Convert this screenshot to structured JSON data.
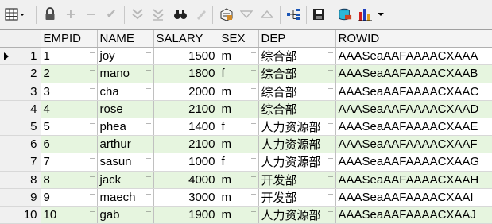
{
  "toolbar": {
    "buttons": [
      {
        "name": "grid-view-icon",
        "enabled": true
      },
      {
        "name": "lock-icon",
        "enabled": true
      },
      {
        "name": "insert-record-icon",
        "enabled": false
      },
      {
        "name": "delete-record-icon",
        "enabled": false
      },
      {
        "name": "post-changes-icon",
        "enabled": false
      },
      {
        "name": "filter-icon",
        "enabled": false
      },
      {
        "name": "filter-clear-icon",
        "enabled": false
      },
      {
        "name": "find-icon",
        "enabled": true
      },
      {
        "name": "clear-icon",
        "enabled": false
      },
      {
        "name": "query-by-example-icon",
        "enabled": true
      },
      {
        "name": "next-page-icon",
        "enabled": false
      },
      {
        "name": "previous-page-icon",
        "enabled": false
      },
      {
        "name": "explain-tree-icon",
        "enabled": true
      },
      {
        "name": "save-icon",
        "enabled": true
      },
      {
        "name": "export-icon",
        "enabled": true
      },
      {
        "name": "chart-icon",
        "enabled": true
      }
    ]
  },
  "table": {
    "columns": [
      "EMPID",
      "NAME",
      "SALARY",
      "SEX",
      "DEP",
      "ROWID"
    ],
    "rows": [
      {
        "rownum": "1",
        "empid": "1",
        "name": "joy",
        "salary": "1500",
        "sex": "m",
        "dep": "综合部",
        "rowid": "AAASeaAAFAAAACXAAA"
      },
      {
        "rownum": "2",
        "empid": "2",
        "name": "mano",
        "salary": "1800",
        "sex": "f",
        "dep": "综合部",
        "rowid": "AAASeaAAFAAAACXAAB"
      },
      {
        "rownum": "3",
        "empid": "3",
        "name": "cha",
        "salary": "2000",
        "sex": "m",
        "dep": "综合部",
        "rowid": "AAASeaAAFAAAACXAAC"
      },
      {
        "rownum": "4",
        "empid": "4",
        "name": "rose",
        "salary": "2100",
        "sex": "m",
        "dep": "综合部",
        "rowid": "AAASeaAAFAAAACXAAD"
      },
      {
        "rownum": "5",
        "empid": "5",
        "name": "phea",
        "salary": "1400",
        "sex": "f",
        "dep": "人力资源部",
        "rowid": "AAASeaAAFAAAACXAAE"
      },
      {
        "rownum": "6",
        "empid": "6",
        "name": "arthur",
        "salary": "2100",
        "sex": "m",
        "dep": "人力资源部",
        "rowid": "AAASeaAAFAAAACXAAF"
      },
      {
        "rownum": "7",
        "empid": "7",
        "name": "sasun",
        "salary": "1000",
        "sex": "f",
        "dep": "人力资源部",
        "rowid": "AAASeaAAFAAAACXAAG"
      },
      {
        "rownum": "8",
        "empid": "8",
        "name": "jack",
        "salary": "4000",
        "sex": "m",
        "dep": "开发部",
        "rowid": "AAASeaAAFAAAACXAAH"
      },
      {
        "rownum": "9",
        "empid": "9",
        "name": "maech",
        "salary": "3000",
        "sex": "m",
        "dep": "开发部",
        "rowid": "AAASeaAAFAAAACXAAI"
      },
      {
        "rownum": "10",
        "empid": "10",
        "name": "gab",
        "salary": "1900",
        "sex": "m",
        "dep": "人力资源部",
        "rowid": "AAASeaAAFAAAACXAAJ"
      }
    ]
  },
  "colors": {
    "alt_row": "#e6f5df",
    "grid_line": "#c0c0c0",
    "header_bg": "#f4f4f4"
  }
}
